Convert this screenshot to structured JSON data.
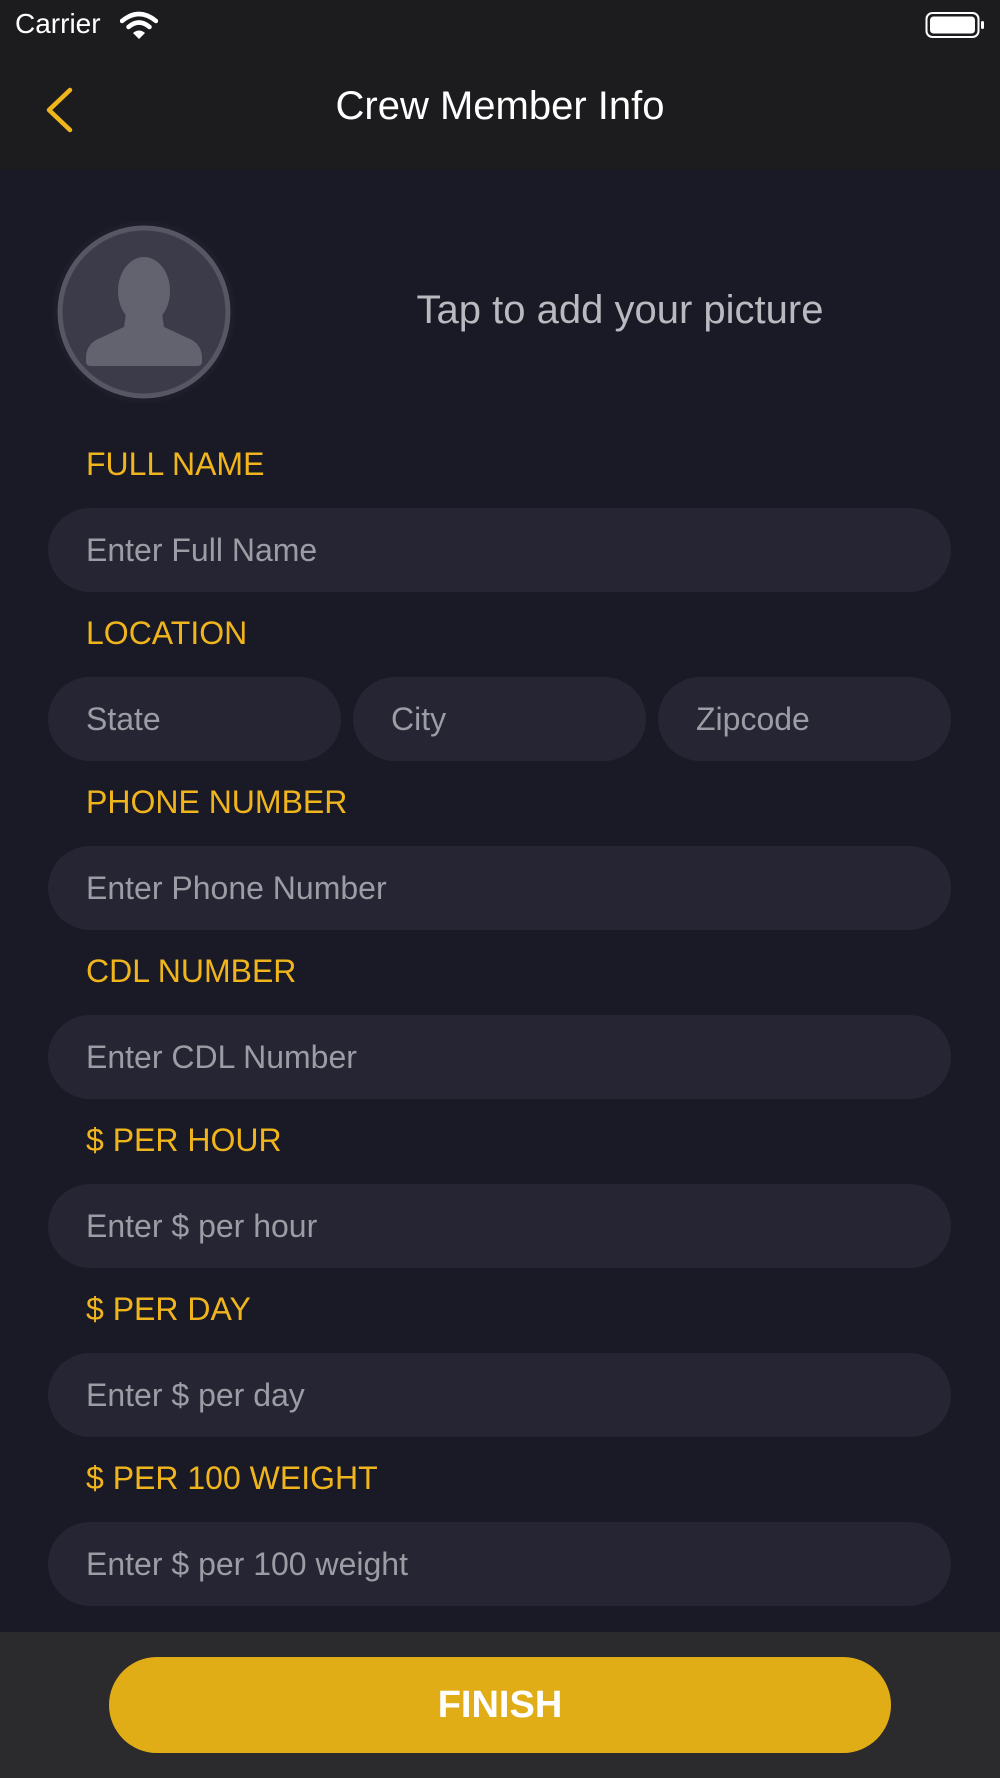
{
  "status_bar": {
    "carrier": "Carrier"
  },
  "nav": {
    "title": "Crew Member Info"
  },
  "profile": {
    "add_picture_text": "Tap to add your picture"
  },
  "form": {
    "full_name": {
      "label": "FULL NAME",
      "placeholder": "Enter Full Name"
    },
    "location": {
      "label": "LOCATION",
      "state_placeholder": "State",
      "city_placeholder": "City",
      "zip_placeholder": "Zipcode"
    },
    "phone": {
      "label": "PHONE NUMBER",
      "placeholder": "Enter Phone Number"
    },
    "cdl": {
      "label": "CDL NUMBER",
      "placeholder": "Enter CDL Number"
    },
    "per_hour": {
      "label": "$ PER HOUR",
      "placeholder": "Enter $ per hour"
    },
    "per_day": {
      "label": "$ PER DAY",
      "placeholder": "Enter $ per day"
    },
    "per_100_weight": {
      "label": "$ PER 100 WEIGHT",
      "placeholder": "Enter $ per 100 weight"
    }
  },
  "footer": {
    "finish_label": "FINISH"
  },
  "colors": {
    "accent": "#f0b51d",
    "button": "#e1ad16",
    "background": "#1a1a26",
    "field": "#252533"
  },
  "icons": {
    "back": "chevron-left-icon",
    "avatar": "person-icon",
    "wifi": "wifi-icon",
    "battery": "battery-icon"
  }
}
